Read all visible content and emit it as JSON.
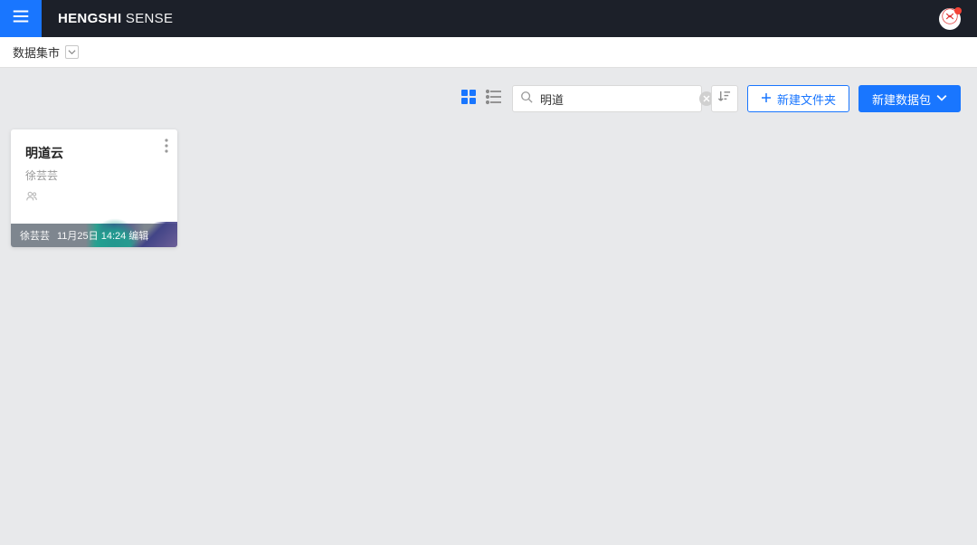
{
  "brand": {
    "bold": "HENGSHI",
    "light": " SENSE"
  },
  "breadcrumb": {
    "label": "数据集市"
  },
  "toolbar": {
    "search_value": "明道",
    "new_folder_label": "新建文件夹",
    "new_package_label": "新建数据包"
  },
  "colors": {
    "accent": "#1976ff",
    "topbar": "#1c2029"
  },
  "cards": [
    {
      "title": "明道云",
      "owner": "徐芸芸",
      "footer_author": "徐芸芸",
      "footer_meta": "11月25日 14:24 编辑"
    }
  ]
}
